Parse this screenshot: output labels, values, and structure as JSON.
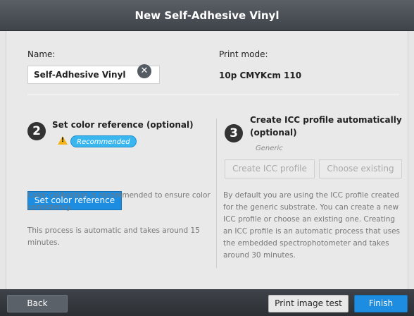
{
  "window": {
    "title": "New Self-Adhesive Vinyl"
  },
  "name_field": {
    "label": "Name:",
    "value": "Self-Adhesive Vinyl",
    "clear_icon": "close-icon"
  },
  "print_mode": {
    "label": "Print mode:",
    "value": "10p CMYKcm 110"
  },
  "color_reference": {
    "step_number": "2",
    "title": "Set color reference (optional)",
    "warning_icon": "warning-icon",
    "badge": "Recommended",
    "button_label": "Set color reference",
    "description_1": "Color calibration is recommended to ensure color consistency.",
    "description_2": "This process is automatic and takes around 15 minutes."
  },
  "icc_profile": {
    "step_number": "3",
    "title_line1": "Create ICC profile automatically",
    "title_line2": "(optional)",
    "subtitle": "Generic",
    "create_button": "Create ICC profile",
    "choose_button": "Choose existing",
    "description": "By default you are using the ICC profile created for the generic substrate. You can create a new ICC profile or choose an existing one. Creating an ICC profile is an automatic process that uses the embedded spectrophotometer and takes around 30 minutes."
  },
  "footer": {
    "back": "Back",
    "print_test": "Print image test",
    "finish": "Finish"
  },
  "colors": {
    "accent": "#1d8de1",
    "badge": "#3ab6ef",
    "warning": "#f2b417",
    "titlebar": "#4a4f55"
  }
}
